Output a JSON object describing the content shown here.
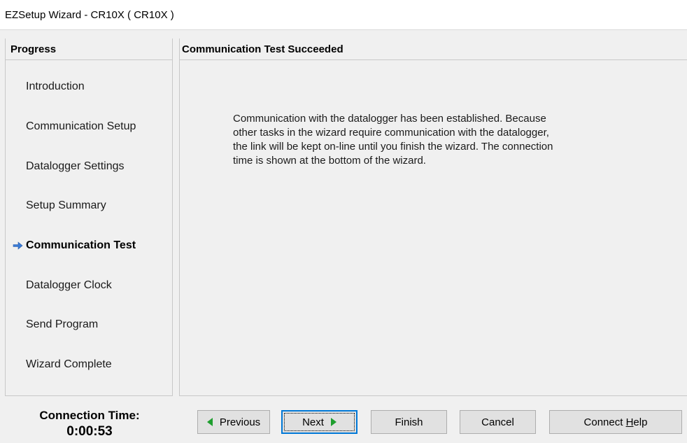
{
  "window": {
    "title": "EZSetup Wizard - CR10X ( CR10X )"
  },
  "progress": {
    "header": "Progress",
    "current_index": 4,
    "items": [
      {
        "label": "Introduction"
      },
      {
        "label": "Communication Setup"
      },
      {
        "label": "Datalogger Settings"
      },
      {
        "label": "Setup Summary"
      },
      {
        "label": "Communication Test"
      },
      {
        "label": "Datalogger Clock"
      },
      {
        "label": "Send Program"
      },
      {
        "label": "Wizard Complete"
      }
    ],
    "current_icon": "right-arrow-icon"
  },
  "content": {
    "header": "Communication Test Succeeded",
    "lines": [
      "Communication with the datalogger has been established.  Because",
      "other tasks in the wizard require communication with the datalogger,",
      "the link will be kept on-line until you finish the wizard.  The connection",
      "time is shown at the bottom of the wizard."
    ]
  },
  "status": {
    "connection_label": "Connection Time:",
    "connection_time": "0:00:53"
  },
  "buttons": {
    "previous": "Previous",
    "next": "Next",
    "finish": "Finish",
    "cancel": "Cancel",
    "connect_help_prefix": "Connect ",
    "connect_help_accel": "H",
    "connect_help_suffix": "elp"
  },
  "colors": {
    "arrow_green": "#1e9e2e",
    "current_arrow_blue": "#3a7bd5",
    "focus_blue": "#0078d7"
  }
}
